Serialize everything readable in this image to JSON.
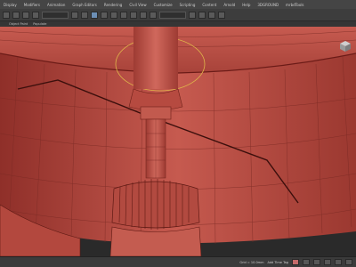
{
  "menus": [
    "Display",
    "Modifiers",
    "Animation",
    "Graph Editors",
    "Rendering",
    "Civil View",
    "Customize",
    "Scripting",
    "Content",
    "Arnold",
    "Help",
    "3DGROUND",
    "mrbdTools"
  ],
  "toolbar": {
    "selection_filter": ""
  },
  "ribbon": {
    "tabs": [
      "",
      "Object Paint",
      "Populate"
    ]
  },
  "viewport": {
    "label": "",
    "mesh_color": "#c8554a",
    "wire_color": "#7a1f1a",
    "highlight_color": "#e0b84a"
  },
  "status": {
    "coord_text": "Grid = 10.0mm",
    "add_time_tag": "Add Time Tag"
  }
}
